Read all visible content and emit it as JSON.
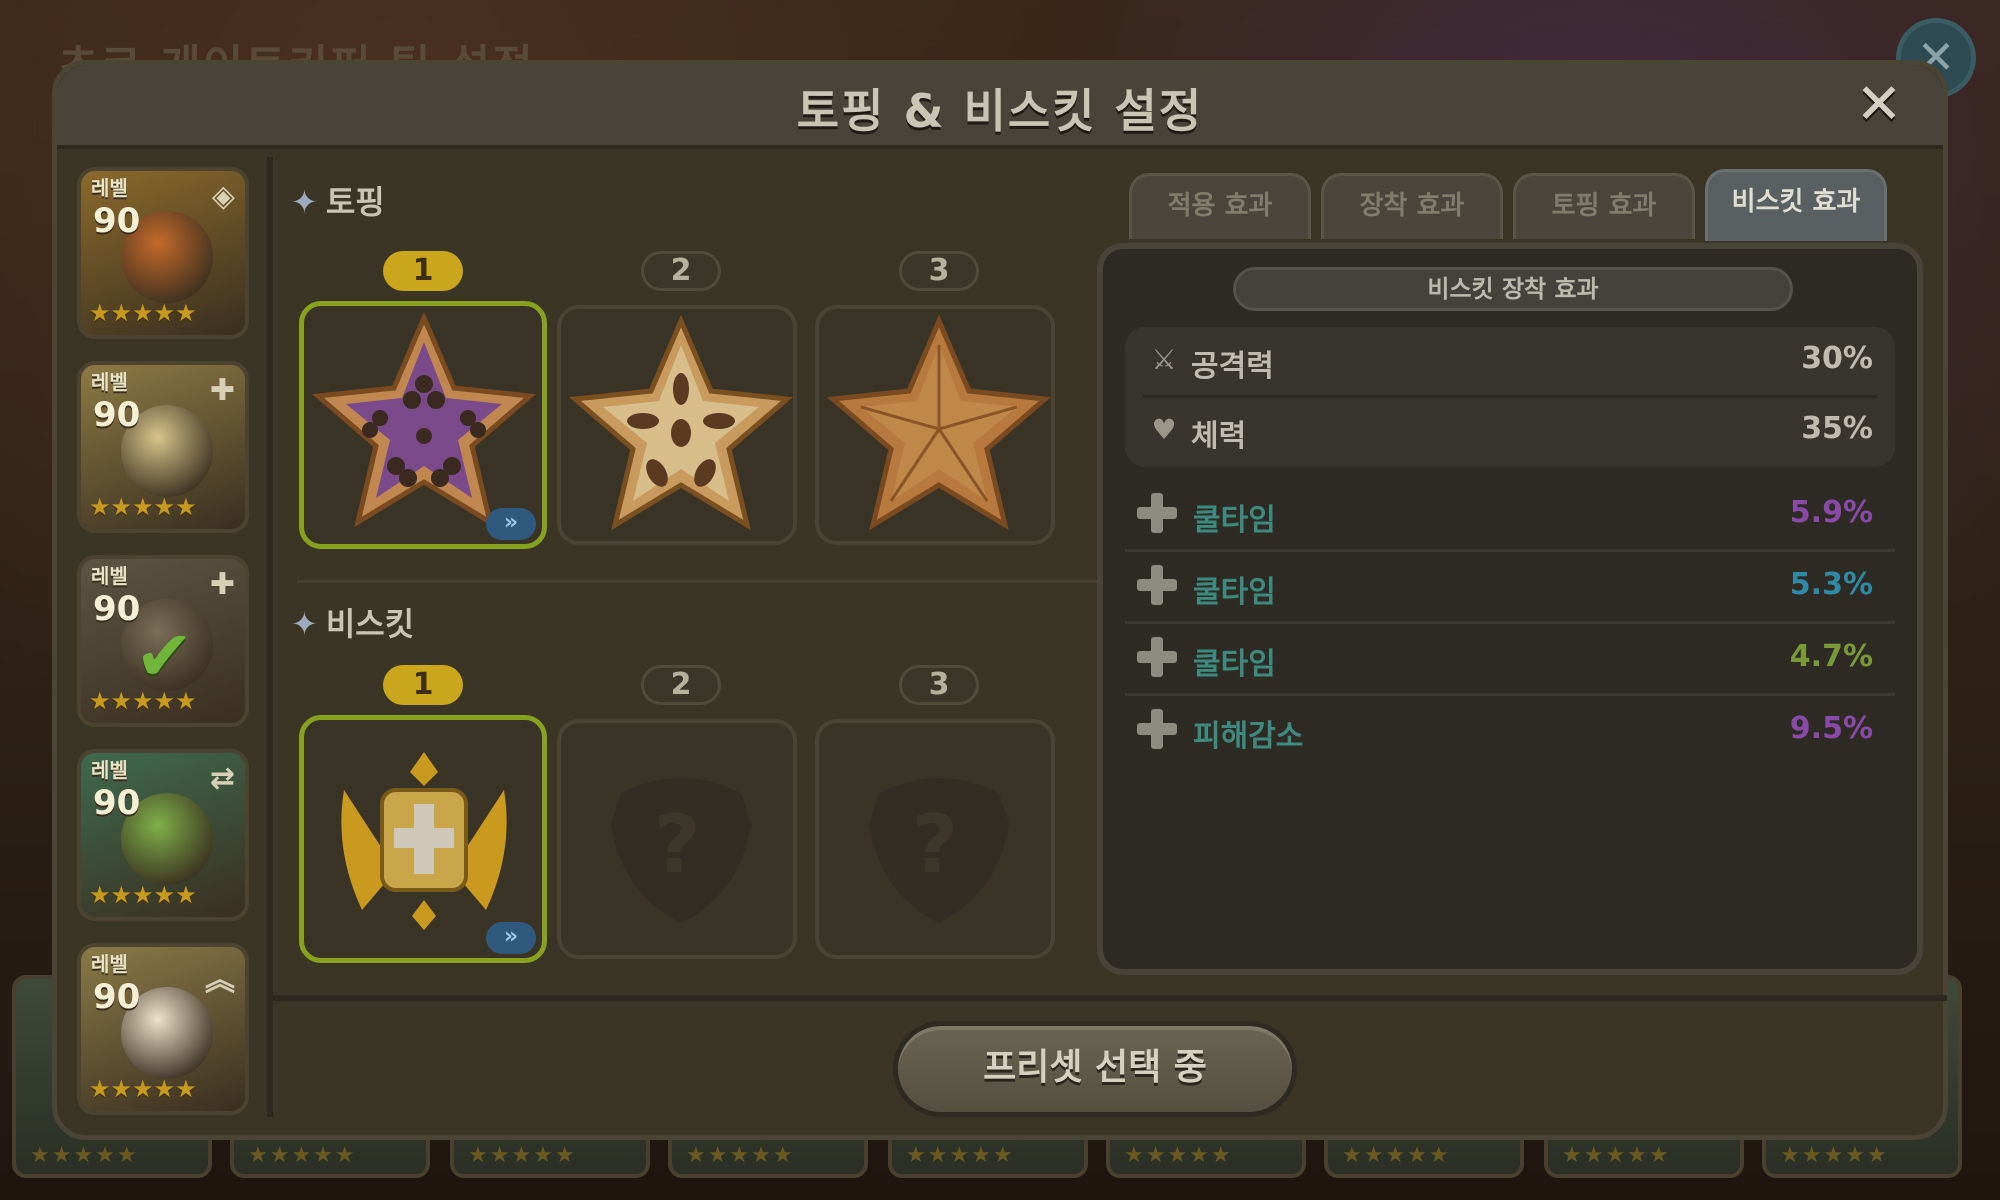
{
  "background": {
    "title": "초코 게이트키퍼 팀 설정",
    "close_glyph": "✕",
    "strip_stars": "★★★★★"
  },
  "dialog": {
    "title": "토핑 & 비스킷 설정",
    "close_glyph": "✕"
  },
  "cookies": [
    {
      "level_label": "레벨",
      "level": "90",
      "stars": "★★★★★",
      "badge": "◈",
      "bg": "#8a6a2c",
      "face": "#c56a2a"
    },
    {
      "level_label": "레벨",
      "level": "90",
      "stars": "★★★★★",
      "badge": "✚",
      "bg": "#8d7a45",
      "face": "#d8c48a"
    },
    {
      "level_label": "레벨",
      "level": "90",
      "stars": "★★★★★",
      "badge": "✚",
      "bg": "#5d5444",
      "face": "#7a6e58",
      "check": "✔"
    },
    {
      "level_label": "레벨",
      "level": "90",
      "stars": "★★★★★",
      "badge": "⇄",
      "bg": "#3f6a4e",
      "face": "#7fb04a"
    },
    {
      "level_label": "레벨",
      "level": "90",
      "stars": "★★★★★",
      "badge": "︽",
      "bg": "#8a7a48",
      "face": "#ece2c8"
    }
  ],
  "toppings": {
    "label": "토핑",
    "spark": "✦",
    "slots": [
      {
        "num": "1",
        "active": true
      },
      {
        "num": "2",
        "active": false
      },
      {
        "num": "3",
        "active": false
      }
    ],
    "forward_glyph": "»"
  },
  "biscuits": {
    "label": "비스킷",
    "spark": "✦",
    "slots": [
      {
        "num": "1",
        "active": true
      },
      {
        "num": "2",
        "active": false,
        "placeholder": "?"
      },
      {
        "num": "3",
        "active": false,
        "placeholder": "?"
      }
    ],
    "forward_glyph": "»"
  },
  "tabs": [
    {
      "label": "적용 효과",
      "active": false
    },
    {
      "label": "장착 효과",
      "active": false
    },
    {
      "label": "토핑 효과",
      "active": false
    },
    {
      "label": "비스킷 효과",
      "active": true
    }
  ],
  "effects": {
    "header": "비스킷 장착 효과",
    "base": [
      {
        "icon": "sword-icon",
        "glyph": "⚔",
        "name": "공격력",
        "value": "30%"
      },
      {
        "icon": "heart-icon",
        "glyph": "♥",
        "name": "체력",
        "value": "35%"
      }
    ],
    "substats": [
      {
        "name": "쿨타임",
        "value": "5.9%",
        "color": "#8a4aa8"
      },
      {
        "name": "쿨타임",
        "value": "5.3%",
        "color": "#2f8aa6"
      },
      {
        "name": "쿨타임",
        "value": "4.7%",
        "color": "#7a9a3a"
      },
      {
        "name": "피해감소",
        "value": "9.5%",
        "color": "#8a4aa8"
      }
    ]
  },
  "preset_button": "프리셋 선택 중",
  "colors": {
    "accent_yellow": "#c9a61c",
    "selected_border": "#86a21f",
    "teal_text": "#3f8a7f"
  }
}
